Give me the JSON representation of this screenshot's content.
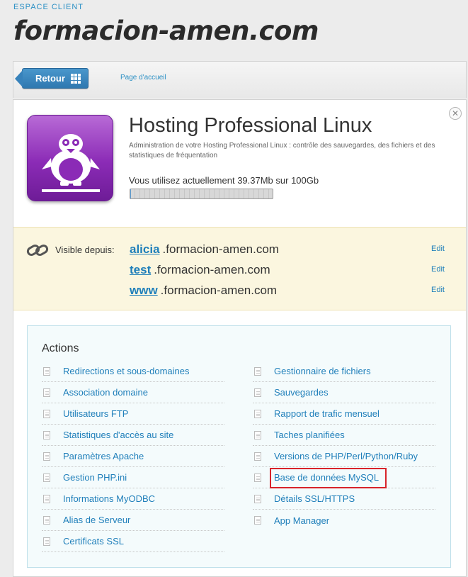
{
  "header": {
    "eyebrow": "ESPACE CLIENT",
    "site_title": "formacion-amen.com"
  },
  "toolbar": {
    "back_label": "Retour",
    "home_link": "Page d'accueil"
  },
  "plan": {
    "title": "Hosting Professional Linux",
    "description": "Administration de votre Hosting Professional Linux : contrôle des sauvegardes, des fichiers et des statistiques de fréquentation",
    "usage_text": "Vous utilisez actuellement 39.37Mb sur 100Gb",
    "usage_fraction": 0.0004
  },
  "domains": {
    "visible_label": "Visible depuis:",
    "edit_label": "Edit",
    "rows": [
      {
        "sub": "alicia",
        "rest": ".formacion-amen.com"
      },
      {
        "sub": "test",
        "rest": ".formacion-amen.com"
      },
      {
        "sub": "www",
        "rest": ".formacion-amen.com"
      }
    ]
  },
  "actions": {
    "title": "Actions",
    "left": [
      "Redirections et sous-domaines",
      "Association domaine",
      "Utilisateurs FTP",
      "Statistiques d'accès au site",
      "Paramètres Apache",
      "Gestion PHP.ini",
      "Informations MyODBC",
      "Alias de Serveur",
      "Certificats SSL"
    ],
    "right": [
      "Gestionnaire de fichiers",
      "Sauvegardes",
      "Rapport de trafic mensuel",
      "Taches planifiées",
      "Versions de PHP/Perl/Python/Ruby",
      "Base de données MySQL",
      "Détails SSL/HTTPS",
      "App Manager"
    ]
  },
  "colors": {
    "accent": "#1f7fba",
    "plan_tile": "#8b2bb6",
    "highlight": "#d8232a",
    "domains_bg": "#fbf6df"
  }
}
